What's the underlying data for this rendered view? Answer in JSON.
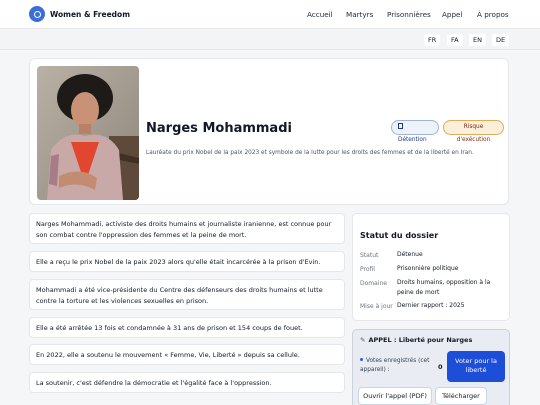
{
  "header": {
    "brand": "Women & Freedom",
    "nav": [
      "Accueil",
      "Martyrs",
      "Prisonnières",
      "Appel",
      "À propos"
    ]
  },
  "languages": [
    "FR",
    "FA",
    "EN",
    "DE"
  ],
  "profile": {
    "name": "Narges Mohammadi",
    "subtitle": "Lauréate du prix Nobel de la paix 2023 et symbole de la lutte pour les droits des femmes et de la liberté en Iran.",
    "badges": [
      "Détention",
      "Risque d'exécution"
    ]
  },
  "paragraphs": [
    "Narges Mohammadi, activiste des droits humains et journaliste iranienne, est connue pour son combat contre l'oppression des femmes et la peine de mort.",
    "Elle a reçu le prix Nobel de la paix 2023 alors qu'elle était incarcérée à la prison d'Evin.",
    "Mohammadi a été vice-présidente du Centre des défenseurs des droits humains et lutte contre la torture et les violences sexuelles en prison.",
    "Elle a été arrêtée 13 fois et condamnée à 31 ans de prison et 154 coups de fouet.",
    "En 2022, elle a soutenu le mouvement « Femme, Vie, Liberté » depuis sa cellule.",
    "La soutenir, c'est défendre la démocratie et l'égalité face à l'oppression."
  ],
  "status": {
    "title": "Statut du dossier",
    "rows": [
      {
        "key": "Statut",
        "value": "Détenue"
      },
      {
        "key": "Profil",
        "value": "Prisonnière politique"
      },
      {
        "key": "Domaine",
        "value": "Droits humains, opposition à la peine de mort"
      },
      {
        "key": "Mise à jour",
        "value": "Dernier rapport : 2025"
      }
    ]
  },
  "appeal": {
    "title": "APPEL : Liberté pour Narges",
    "votes_label": "Votes enregistrés (cet appareil) :",
    "votes_count": "0",
    "vote_button": "Voter pour la liberté",
    "pdf_button": "Ouvrir l'appel (PDF)",
    "download_button": "Télécharger"
  },
  "colors": {
    "accent": "#1d4ed8",
    "brand_logo": "#3b6fd8",
    "risk_badge": "#fcefd9"
  }
}
